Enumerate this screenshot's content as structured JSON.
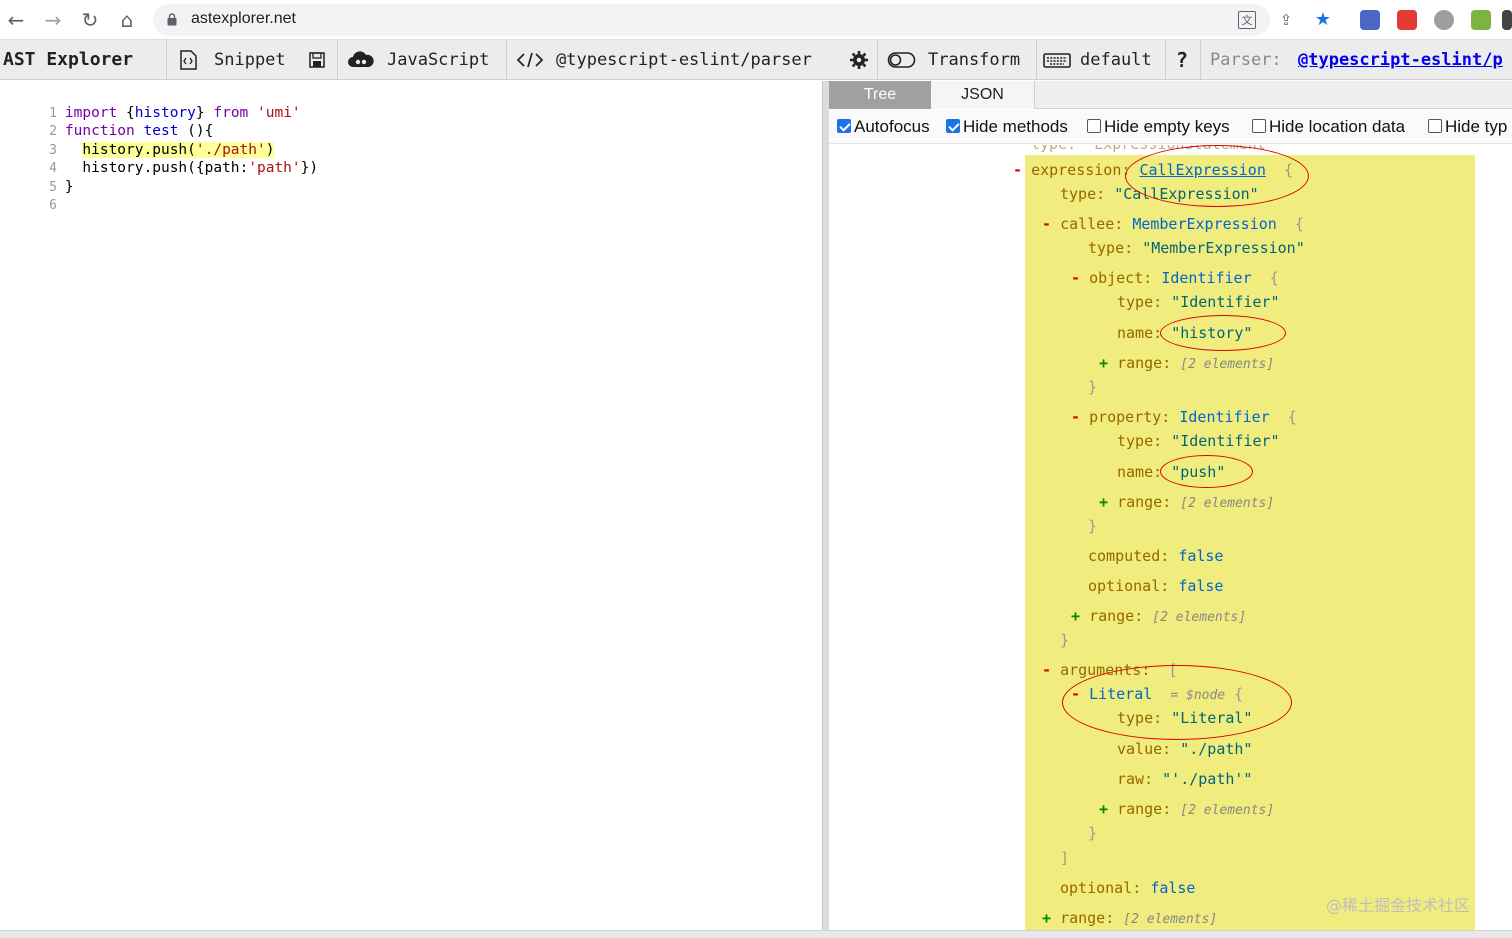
{
  "browser": {
    "url": "astexplorer.net",
    "back_glyph": "←",
    "forward_glyph": "→",
    "reload_glyph": "↻",
    "home_glyph": "⌂",
    "translate_glyph": "文",
    "share_glyph": "⇪",
    "star_glyph": "★"
  },
  "toolbar": {
    "brand": "AST Explorer",
    "snippet": "Snippet",
    "language": "JavaScript",
    "parser": "@typescript-eslint/parser",
    "transform": "Transform",
    "keymap": "default",
    "help": "?",
    "parser_label": "Parser:",
    "parser_link": "@typescript-eslint/p"
  },
  "editor": {
    "lines": [
      {
        "n": "1"
      },
      {
        "n": "2"
      },
      {
        "n": "3"
      },
      {
        "n": "4"
      },
      {
        "n": "5"
      },
      {
        "n": "6"
      }
    ],
    "tokens": {
      "l1_import": "import",
      "l1_brace_open": " {",
      "l1_history": "history",
      "l1_brace_close": "} ",
      "l1_from": "from",
      "l1_space": " ",
      "l1_str": "'umi'",
      "l2_function": "function",
      "l2_space": " ",
      "l2_test": "test",
      "l2_rest": " (){",
      "l3_indent": "  ",
      "l3_call": "history.push(",
      "l3_str": "'./path'",
      "l3_close": ")",
      "l4_indent": "  ",
      "l4_call": "history.push({path:",
      "l4_str": "'path'",
      "l4_close": "})",
      "l5_close": "}"
    }
  },
  "output": {
    "tabs": {
      "tree": "Tree",
      "json": "JSON"
    },
    "options": {
      "autofocus": "Autofocus",
      "hide_methods": "Hide methods",
      "hide_empty_keys": "Hide empty keys",
      "hide_location_data": "Hide location data",
      "hide_type": "Hide typ"
    },
    "tree": {
      "cut_top": "type: \"ExpressionStatement\"",
      "expression_key": "expression:",
      "expression_type": "CallExpression",
      "brace_open": "{",
      "type_key": "type:",
      "call_expression_str": "\"CallExpression\"",
      "callee_key": "callee:",
      "member_expression": "MemberExpression",
      "member_expression_str": "\"MemberExpression\"",
      "object_key": "object:",
      "identifier": "Identifier",
      "identifier_str": "\"Identifier\"",
      "name_key": "name:",
      "history_str": "\"history\"",
      "range_key": "range:",
      "range_meta": "[2 elements]",
      "brace_close": "}",
      "property_key": "property:",
      "push_str": "\"push\"",
      "computed_key": "computed:",
      "optional_key": "optional:",
      "false_val": "false",
      "arguments_key": "arguments:",
      "bracket_open": "[",
      "literal": "Literal",
      "node_meta": "= $node",
      "literal_str": "\"Literal\"",
      "value_key": "value:",
      "path_str": "\"./path\"",
      "raw_key": "raw:",
      "raw_str": "\"'./path'\"",
      "bracket_close": "]",
      "minus": "-",
      "plus": "+"
    }
  },
  "watermark": "@稀土掘金技术社区"
}
